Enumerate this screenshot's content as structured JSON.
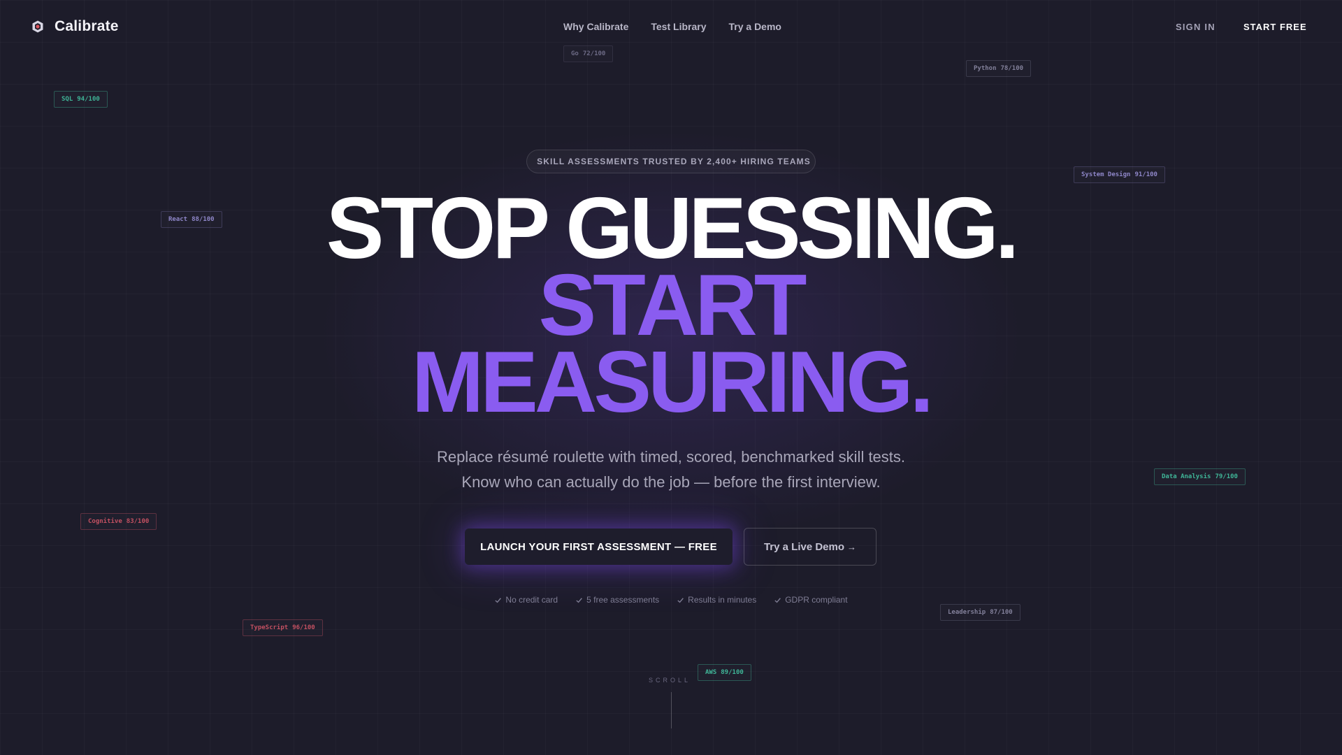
{
  "nav": {
    "brand": "Calibrate",
    "links": [
      {
        "label": "Why Calibrate"
      },
      {
        "label": "Test Library"
      },
      {
        "label": "Try a Demo"
      }
    ],
    "sign_in": "SIGN IN",
    "start_free": "START FREE"
  },
  "tags": [
    {
      "skill": "Go",
      "score": "72/100",
      "color": "dim"
    },
    {
      "skill": "Python",
      "score": "78/100",
      "color": "grey"
    },
    {
      "skill": "SQL",
      "score": "94/100",
      "color": "green"
    },
    {
      "skill": "System Design",
      "score": "91/100",
      "color": "purple"
    },
    {
      "skill": "React",
      "score": "88/100",
      "color": "purple"
    },
    {
      "skill": "Data Analysis",
      "score": "79/100",
      "color": "green"
    },
    {
      "skill": "Cognitive",
      "score": "83/100",
      "color": "red"
    },
    {
      "skill": "Leadership",
      "score": "87/100",
      "color": "grey"
    },
    {
      "skill": "TypeScript",
      "score": "96/100",
      "color": "red"
    },
    {
      "skill": "AWS",
      "score": "89/100",
      "color": "green"
    }
  ],
  "hero": {
    "pill": "SKILL ASSESSMENTS TRUSTED BY 2,400+ HIRING TEAMS",
    "headline_line1": "STOP GUESSING.",
    "headline_line2": "START",
    "headline_line3": "MEASURING.",
    "subtitle_line1": "Replace résumé roulette with timed, scored, benchmarked skill tests.",
    "subtitle_line2": "Know who can actually do the job — before the first interview.",
    "cta_primary": "LAUNCH YOUR FIRST ASSESSMENT — FREE",
    "cta_secondary": "Try a Live Demo",
    "cta_secondary_arrow": "→",
    "checks": [
      "No credit card",
      "5 free assessments",
      "Results in minutes",
      "GDPR compliant"
    ],
    "scroll": "SCROLL"
  },
  "colors": {
    "accent": "#8a5cf0",
    "background": "#1d1c2a",
    "tag_green": "#3fb597",
    "tag_red": "#c25061",
    "tag_purple": "#8e86c8"
  }
}
